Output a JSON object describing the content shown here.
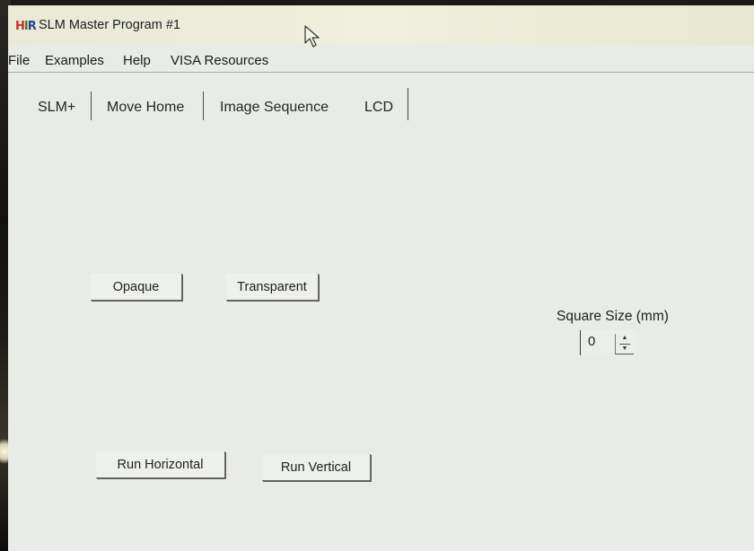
{
  "window": {
    "icon_text": "HR",
    "title": "SLM Master Program #1"
  },
  "menu": {
    "items": [
      "File",
      "Examples",
      "Help",
      "VISA Resources"
    ]
  },
  "tabs": [
    "SLM+",
    "Move Home",
    "Image Sequence",
    "LCD"
  ],
  "buttons": {
    "opaque": "Opaque",
    "transparent": "Transparent",
    "run_horizontal": "Run Horizontal",
    "run_vertical": "Run Vertical"
  },
  "square_size": {
    "label": "Square Size (mm)",
    "value": "0"
  },
  "icons": {
    "cursor": "mouse-pointer-icon",
    "spin_up": "spin-up-icon",
    "spin_down": "spin-down-icon"
  }
}
